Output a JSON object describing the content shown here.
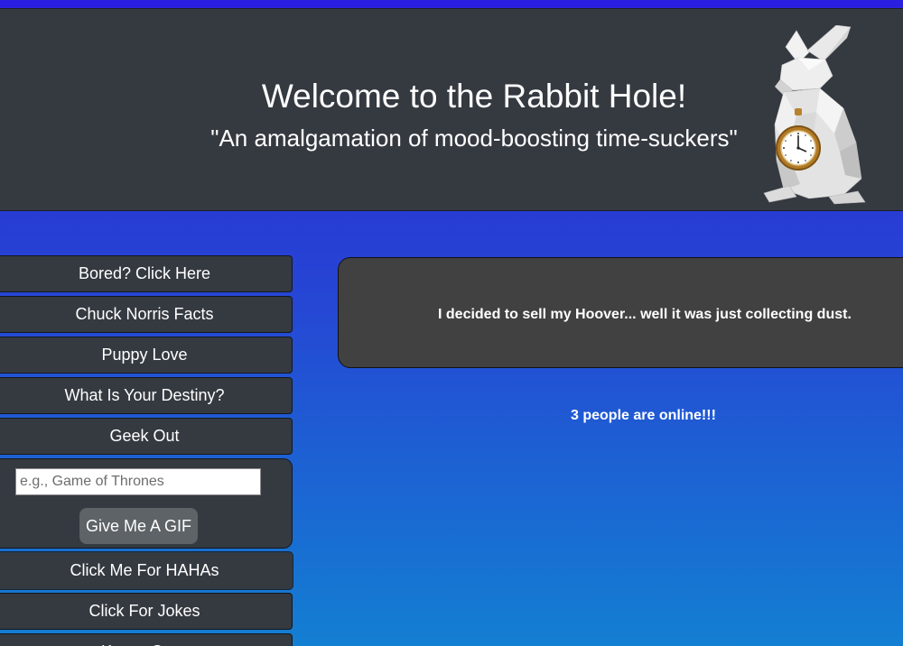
{
  "header": {
    "title": "Welcome to the Rabbit Hole!",
    "subtitle": "\"An amalgamation of mood-boosting time-suckers\"",
    "logo": "white-rabbit-with-pocket-watch"
  },
  "nav": {
    "buttons": [
      "Bored? Click Here",
      "Chuck Norris Facts",
      "Puppy Love",
      "What Is Your Destiny?",
      "Geek Out"
    ],
    "gif_search": {
      "placeholder": "e.g., Game of Thrones",
      "value": "",
      "button_label": "Give Me A GIF"
    },
    "buttons_after": [
      "Click Me For HAHAs",
      "Click For Jokes",
      "Kanye Says"
    ]
  },
  "main": {
    "joke": "I decided to sell my Hoover... well it was just collecting dust.",
    "online_status": "3 people are online!!!"
  },
  "colors": {
    "header_bg": "#353a41",
    "gradient_top": "#2c24d2",
    "gradient_bottom": "#137fd2",
    "joke_bg": "#414141",
    "gif_button_bg": "#5e6367"
  }
}
